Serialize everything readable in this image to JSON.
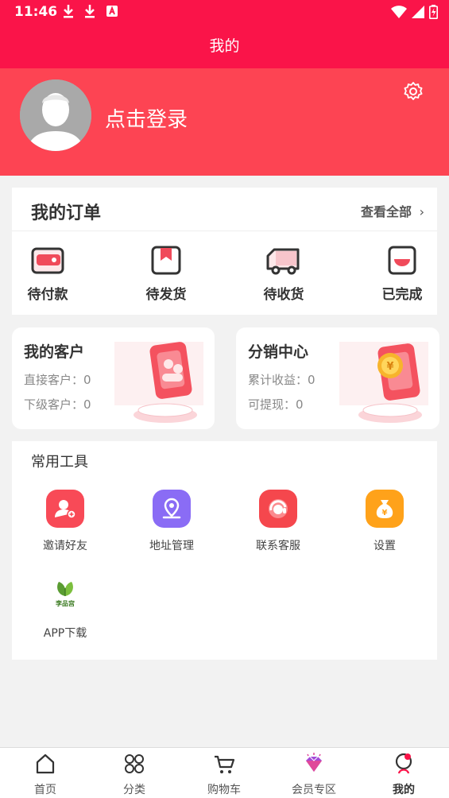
{
  "status": {
    "time": "11:46"
  },
  "header": {
    "title": "我的"
  },
  "profile": {
    "login": "点击登录"
  },
  "orders": {
    "title": "我的订单",
    "view_all": "查看全部",
    "chevron": "›",
    "items": [
      {
        "label": "待付款",
        "icon": "wallet-icon"
      },
      {
        "label": "待发货",
        "icon": "bookmark-box-icon"
      },
      {
        "label": "待收货",
        "icon": "truck-icon"
      },
      {
        "label": "已完成",
        "icon": "completed-box-icon"
      }
    ]
  },
  "customers": {
    "title": "我的客户",
    "direct": "直接客户：0",
    "sub": "下级客户：0"
  },
  "distribution": {
    "title": "分销中心",
    "earnings": "累计收益：0",
    "withdraw": "可提现：0"
  },
  "tools": {
    "title": "常用工具",
    "items": [
      {
        "label": "邀请好友",
        "icon": "add-user-icon",
        "color": "#f84a57"
      },
      {
        "label": "地址管理",
        "icon": "location-icon",
        "color": "#8a6cf5"
      },
      {
        "label": "联系客服",
        "icon": "customer-service-icon",
        "color": "#f5474d"
      },
      {
        "label": "设置",
        "icon": "money-bag-icon",
        "color": "#ffa21a"
      },
      {
        "label": "APP下载",
        "icon": "app-logo-icon",
        "color": "#ffffff"
      }
    ],
    "app_logo_text": "李品宫"
  },
  "tabbar": {
    "items": [
      {
        "label": "首页",
        "icon": "home-icon"
      },
      {
        "label": "分类",
        "icon": "category-icon"
      },
      {
        "label": "购物车",
        "icon": "cart-icon"
      },
      {
        "label": "会员专区",
        "icon": "diamond-icon"
      },
      {
        "label": "我的",
        "icon": "profile-icon"
      }
    ]
  },
  "colors": {
    "brand": "#fa1449",
    "profile_bg": "#fd4453"
  }
}
